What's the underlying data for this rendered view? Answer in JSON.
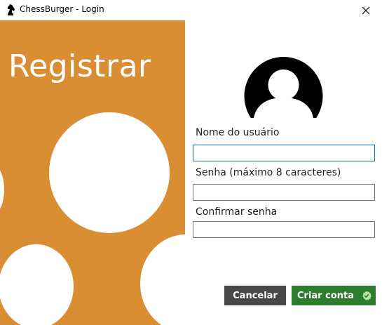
{
  "window": {
    "title": "ChessBurger - Login",
    "app_icon": "chess-knight-icon",
    "close_icon": "close-icon"
  },
  "left_panel": {
    "heading": "Registrar",
    "background_color": "#d98e33"
  },
  "form": {
    "avatar_icon": "user-avatar-icon",
    "username_label": "Nome do usuário",
    "username_value": "",
    "password_label": "Senha (máximo 8 caracteres)",
    "password_value": "",
    "confirm_label": "Confirmar senha",
    "confirm_value": ""
  },
  "buttons": {
    "cancel_label": "Cancelar",
    "create_label": "Criar conta",
    "create_icon": "check-badge-icon",
    "cancel_color": "#4a4747",
    "create_color": "#2e7d2e"
  }
}
